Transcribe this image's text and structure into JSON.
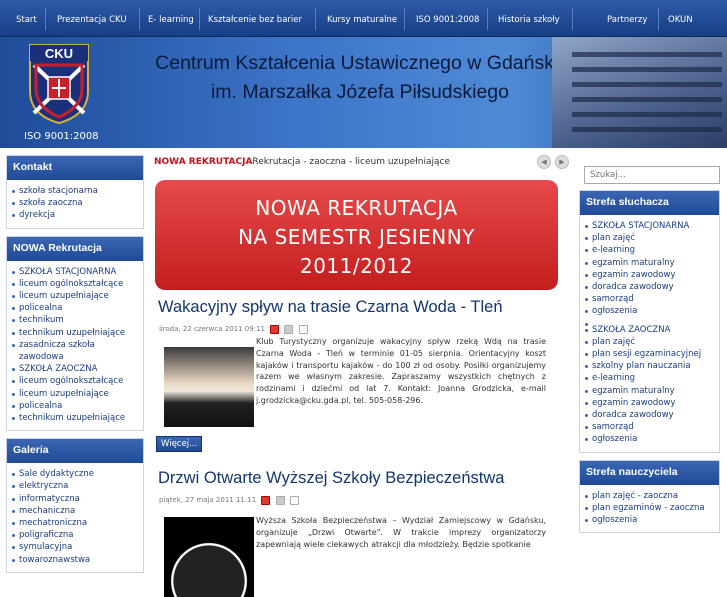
{
  "nav": [
    "Start",
    "Prezentacja CKU",
    "E- learning",
    "Kształcenie bez barier",
    "Kursy maturalne",
    "ISO 9001:2008",
    "Historia szkoły",
    "Partnerzy",
    "OKUN"
  ],
  "header": {
    "crest_text": "CKU",
    "iso": "ISO 9001:2008",
    "title_line1": "Centrum Kształcenia Ustawicznego w Gdańsku",
    "title_line2": "im. Marszałka Józefa Piłsudskiego"
  },
  "left": {
    "kontakt": {
      "title": "Kontakt",
      "items": [
        "szkoła stacjonarna",
        "szkoła zaoczna",
        "dyrekcja"
      ]
    },
    "rekrutacja": {
      "title": "NOWA Rekrutacja",
      "items": [
        "SZKOŁA STACJONARNA",
        "liceum ogólnokształcące",
        "liceum uzupełniające",
        "policealna",
        "technikum",
        "technikum uzupełniające",
        "zasadnicza szkoła zawodowa",
        "SZKOŁA ZAOCZNA",
        "liceum ogólnokształcące",
        "liceum uzupełniające",
        "policealna",
        "technikum uzupełniające"
      ]
    },
    "galeria": {
      "title": "Galeria",
      "items": [
        "Sale dydaktyczne",
        "elektryczna",
        "informatyczna",
        "mechaniczna",
        "mechatroniczna",
        "poligraficzna",
        "symulacyjna",
        "towaroznawstwa"
      ]
    }
  },
  "ticker": {
    "label": "NOWA REKRUTACJA",
    "text": "Rekrutacja - zaoczna - liceum uzupełniające"
  },
  "banner": {
    "line1": "NOWA REKRUTACJA",
    "line2": "NA SEMESTR JESIENNY",
    "line3": "2011/2012"
  },
  "articles": [
    {
      "title": "Wakacyjny spływ na trasie Czarna Woda - Tleń",
      "meta": "środa, 22 czerwca 2011 09:11",
      "text": "Klub Turystyczny organizuje wakacyjny spływ rzeką Wdą na trasie Czarna Woda - Tleń w terminie 01-05 sierpnia. Orientacyjny koszt kajaków i transportu kajaków - do 100 zł od osoby. Posiłki organizujemy razem we własnym zakresie. Zapraszamy wszystkich chętnych z rodzinami i dziećmi od lat 7. Kontakt: Joanna Grodzicka, e-mail j.grodzicka@cku.gda.pl, tel. 505-058-296.",
      "more": "Więcej..."
    },
    {
      "title": "Drzwi Otwarte Wyższej Szkoły Bezpieczeństwa",
      "meta": "piątek, 27 maja 2011 11:11",
      "text": "Wyższa Szkoła Bezpieczeństwa – Wydział Zamiejscowy w Gdańsku, organizuje „Drzwi Otwarte\". W trakcie imprezy organizatorzy zapewniają wiele ciekawych atrakcji dla młodzieży. Będzie spotkanie"
    }
  ],
  "search": {
    "placeholder": "Szukaj..."
  },
  "right": {
    "sluchacza": {
      "title": "Strefa słuchacza",
      "items": [
        "SZKOŁA STACJONARNA",
        "plan zajęć",
        "e-learning",
        "egzamin maturalny",
        "egzamin zawodowy",
        "doradca zawodowy",
        "samorząd",
        "ogłoszenia",
        "",
        "SZKOŁA ZAOCZNA",
        "plan zajęć",
        "plan sesji egzaminacyjnej",
        "szkolny plan nauczania",
        "e-learning",
        "egzamin maturalny",
        "egzamin zawodowy",
        "doradca zawodowy",
        "samorząd",
        "ogłoszenia"
      ]
    },
    "nauczyciela": {
      "title": "Strefa nauczyciela",
      "items": [
        "plan zajęć - zaoczna",
        "plan egzaminów - zaoczna",
        "ogłoszenia"
      ]
    }
  },
  "colors": {
    "nav": "#1f4a95",
    "accent_red": "#c0121b",
    "banner": "#d42a2a",
    "link": "#1a3d80"
  }
}
